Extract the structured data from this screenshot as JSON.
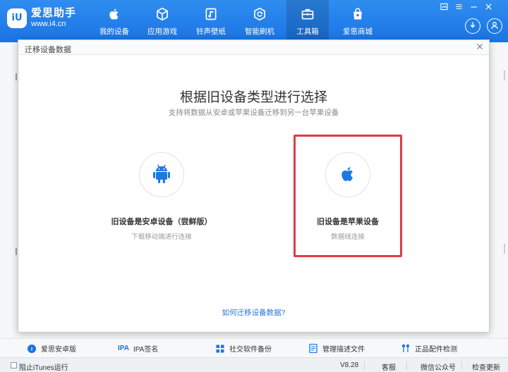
{
  "app": {
    "name": "爱思助手",
    "url": "www.i4.cn",
    "logo_mark": "iU"
  },
  "nav": [
    {
      "label": "我的设备",
      "icon": "apple-icon"
    },
    {
      "label": "应用游戏",
      "icon": "cube-icon"
    },
    {
      "label": "铃声壁纸",
      "icon": "music-icon"
    },
    {
      "label": "智能刷机",
      "icon": "refresh-icon"
    },
    {
      "label": "工具箱",
      "icon": "toolbox-icon",
      "active": true
    },
    {
      "label": "爱思商城",
      "icon": "shopping-bag-icon"
    }
  ],
  "dialog": {
    "title": "迁移设备数据",
    "heading": "根据旧设备类型进行选择",
    "subheading": "支持将数据从安卓或苹果设备迁移到另一台苹果设备",
    "options": [
      {
        "title": "旧设备是安卓设备（尝鲜版）",
        "desc": "下载移动端进行连接",
        "icon": "android-icon",
        "selected": false
      },
      {
        "title": "旧设备是苹果设备",
        "desc": "数据线连接",
        "icon": "apple-icon",
        "selected": true
      }
    ],
    "help_link": "如何迁移设备数据?"
  },
  "toolbar": [
    {
      "label": "爱思安卓版",
      "icon": "android-app-icon"
    },
    {
      "label": "IPA签名",
      "badge": "IPA"
    },
    {
      "label": "社交软件备份",
      "icon": "grid-icon"
    },
    {
      "label": "管理描述文件",
      "icon": "profile-icon"
    },
    {
      "label": "正品配件检测",
      "icon": "earphone-icon"
    }
  ],
  "status": {
    "itunes_label": "阻止iTunes运行",
    "version": "V8.28",
    "feedback": "客服",
    "wechat": "微信公众号",
    "update": "检查更新"
  },
  "colors": {
    "brand": "#1a74e4",
    "selected_border": "#e03a45",
    "link": "#2377d6",
    "android": "#1f78e0"
  }
}
